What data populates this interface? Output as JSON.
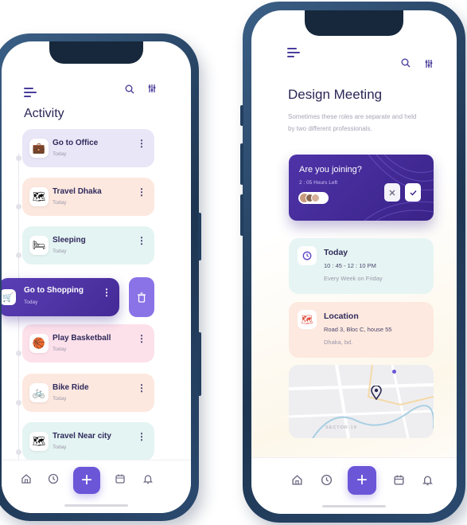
{
  "left": {
    "title": "Activity",
    "activities": [
      {
        "title": "Go to Office",
        "sub": "Today",
        "icon": "briefcase-icon",
        "glyph": "💼",
        "bg": "#e9e6f7"
      },
      {
        "title": "Travel Dhaka",
        "sub": "Today",
        "icon": "map-icon",
        "glyph": "🗺",
        "bg": "#fde8df"
      },
      {
        "title": "Sleeping",
        "sub": "Today",
        "icon": "bed-icon",
        "glyph": "🛏",
        "bg": "#e4f4f2"
      },
      {
        "title": "Play Basketball",
        "sub": "Today",
        "icon": "basketball-icon",
        "glyph": "🏀",
        "bg": "#fde1ea"
      },
      {
        "title": "Bike Ride",
        "sub": "Today",
        "icon": "bike-icon",
        "glyph": "🚲",
        "bg": "#fde8df"
      },
      {
        "title": "Travel Near city",
        "sub": "Today",
        "icon": "map-icon",
        "glyph": "🗺",
        "bg": "#e4f4f2"
      }
    ],
    "swiped": {
      "title": "Go to Shopping",
      "sub": "Today",
      "icon": "cart-icon",
      "delete_icon": "trash-icon"
    },
    "tabs": [
      "home-icon",
      "clock-icon",
      "plus-icon",
      "calendar-icon",
      "bell-icon"
    ]
  },
  "right": {
    "title": "Design Meeting",
    "description": "Sometimes these roles are separate and held by two different professionals.",
    "join": {
      "question": "Are you joining?",
      "time_left": "2 : 05 Hours Left",
      "decline_icon": "close-icon",
      "accept_icon": "check-icon"
    },
    "time_card": {
      "title": "Today",
      "time": "10 : 45 - 12 : 10 PM",
      "repeat": "Every Week on Friday",
      "icon": "clock-icon"
    },
    "location_card": {
      "title": "Location",
      "address": "Road 3, Bloc C, house 55",
      "city": "Dhaka, bd.",
      "icon": "map-icon"
    },
    "map": {
      "label": "SECTOR-19",
      "pin_icon": "location-pin-icon"
    },
    "tabs": [
      "home-icon",
      "clock-icon",
      "plus-icon",
      "calendar-icon",
      "bell-icon"
    ]
  },
  "colors": {
    "accent": "#6b56d8",
    "purple_card": "#4a2f9c",
    "text_dark": "#2f2a5c"
  }
}
